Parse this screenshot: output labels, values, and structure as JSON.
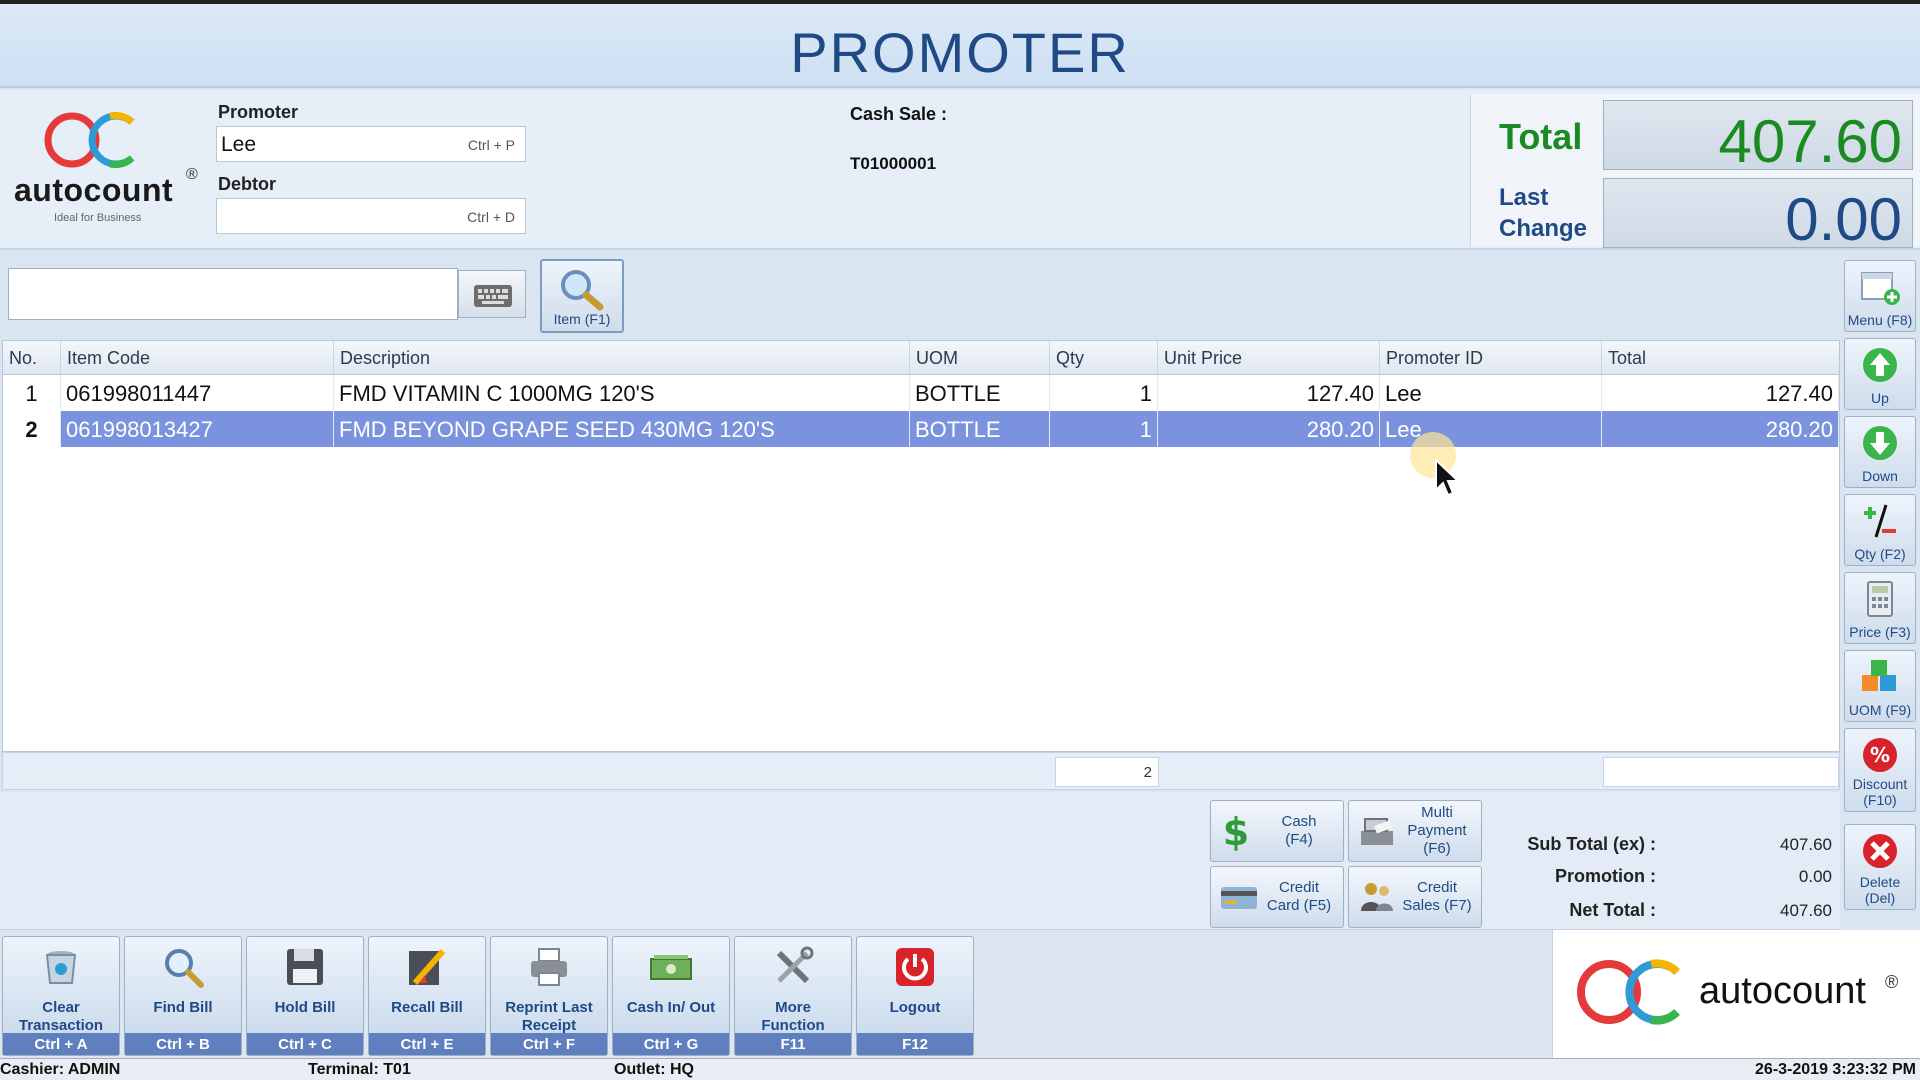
{
  "window": {
    "title": "PROMOTER"
  },
  "logo": {
    "brand": "autocount",
    "reg": "®",
    "tagline": "Ideal for Business"
  },
  "header": {
    "promoter_label": "Promoter",
    "promoter_value": "Lee",
    "promoter_shortcut": "Ctrl + P",
    "debtor_label": "Debtor",
    "debtor_value": "",
    "debtor_shortcut": "Ctrl + D",
    "cash_sale_label": "Cash Sale :",
    "cash_sale_no": "T01000001"
  },
  "totals": {
    "total_label": "Total",
    "total_value": "407.60",
    "change_label_1": "Last",
    "change_label_2": "Change",
    "change_value": "0.00"
  },
  "search": {
    "value": "",
    "item_button": "Item (F1)"
  },
  "grid": {
    "columns": [
      "No.",
      "Item Code",
      "Description",
      "UOM",
      "Qty",
      "Unit Price",
      "Promoter ID",
      "Total"
    ],
    "rows": [
      {
        "no": "1",
        "code": "061998011447",
        "desc": "FMD VITAMIN C 1000MG 120'S",
        "uom": "BOTTLE",
        "qty": "1",
        "price": "127.40",
        "promoter": "Lee",
        "total": "127.40"
      },
      {
        "no": "2",
        "code": "061998013427",
        "desc": "FMD BEYOND GRAPE SEED 430MG 120'S",
        "uom": "BOTTLE",
        "qty": "1",
        "price": "280.20",
        "promoter": "Lee",
        "total": "280.20"
      }
    ],
    "footer_qty": "2",
    "selected_row": 1
  },
  "sidebar": {
    "menu": "Menu (F8)",
    "up": "Up",
    "down": "Down",
    "qty": "Qty (F2)",
    "price": "Price (F3)",
    "uom": "UOM (F9)",
    "discount_1": "Discount",
    "discount_2": "(F10)",
    "delete_1": "Delete",
    "delete_2": "(Del)"
  },
  "payment": {
    "cash_1": "Cash",
    "cash_2": "(F4)",
    "multi_1": "Multi",
    "multi_2": "Payment",
    "multi_3": "(F6)",
    "credit_card_1": "Credit",
    "credit_card_2": "Card (F5)",
    "credit_sales_1": "Credit",
    "credit_sales_2": "Sales (F7)"
  },
  "summary": {
    "subtotal_label": "Sub Total (ex) :",
    "subtotal_value": "407.60",
    "promotion_label": "Promotion :",
    "promotion_value": "0.00",
    "net_label": "Net Total :",
    "net_value": "407.60"
  },
  "toolbar": {
    "clear_1": "Clear",
    "clear_2": "Transaction",
    "clear_key": "Ctrl + A",
    "find": "Find Bill",
    "find_key": "Ctrl + B",
    "hold": "Hold Bill",
    "hold_key": "Ctrl + C",
    "recall": "Recall Bill",
    "recall_key": "Ctrl + E",
    "reprint_1": "Reprint Last",
    "reprint_2": "Receipt",
    "reprint_key": "Ctrl + F",
    "cashinout": "Cash In/ Out",
    "cashinout_key": "Ctrl + G",
    "more_1": "More",
    "more_2": "Function",
    "more_key": "F11",
    "logout": "Logout",
    "logout_key": "F12"
  },
  "status": {
    "cashier": "Cashier: ADMIN",
    "terminal": "Terminal: T01",
    "outlet": "Outlet: HQ",
    "datetime": "26-3-2019 3:23:32 PM"
  },
  "colors": {
    "accent": "#1f4a86",
    "total_green": "#1b8a23",
    "selection": "#7b93de"
  }
}
